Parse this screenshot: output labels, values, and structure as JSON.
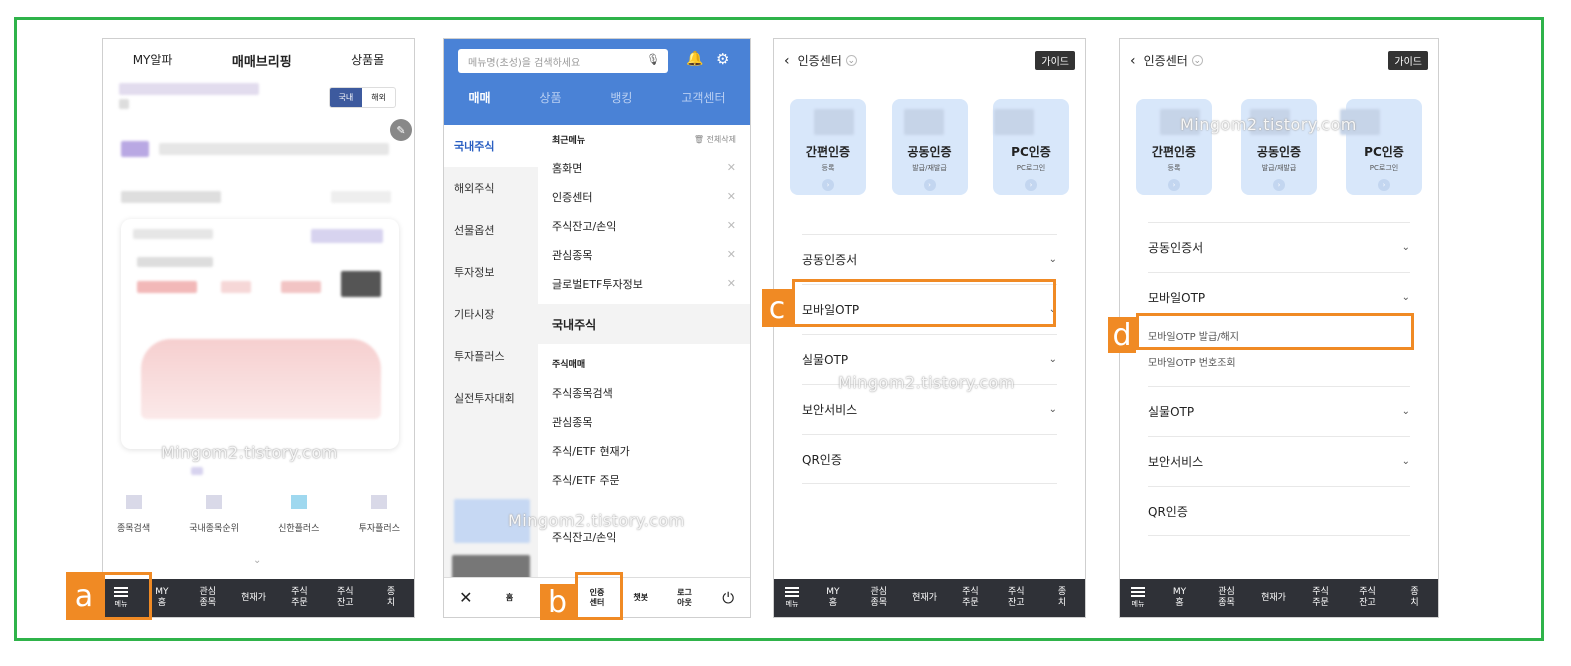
{
  "watermark": "Mingom2.tistory.com",
  "labels": {
    "a": "a",
    "b": "b",
    "c": "c",
    "d": "d"
  },
  "colors": {
    "frame": "#2fb34a",
    "highlight": "#f08a24",
    "header_blue": "#4a82d6"
  },
  "phone1": {
    "tabs": [
      "MY알파",
      "매매브리핑",
      "상품몰"
    ],
    "toggle": [
      "국내",
      "해외"
    ],
    "quick_menu": [
      "종목검색",
      "국내종목순위",
      "신한플러스",
      "투자플러스"
    ],
    "bottom_bar": {
      "menu": "메뉴",
      "items": [
        "MY\n홈",
        "관심\n종목",
        "현재가",
        "주식\n주문",
        "주식\n잔고",
        "종\n치"
      ]
    }
  },
  "phone2": {
    "search_placeholder": "메뉴명(초성)을 검색하세요",
    "tabs": [
      "매매",
      "상품",
      "뱅킹",
      "고객센터"
    ],
    "left_nav": [
      "국내주식",
      "해외주식",
      "선물옵션",
      "투자정보",
      "기타시장",
      "투자플러스",
      "실전투자대회"
    ],
    "recent_header": "최근메뉴",
    "delete_all": "전체삭제",
    "recent_items": [
      "홈화면",
      "인증센터",
      "주식잔고/손익",
      "관심종목",
      "글로벌ETF투자정보"
    ],
    "section_title": "국내주식",
    "sub_title": "주식매매",
    "items": [
      "주식종목검색",
      "관심종목",
      "주식/ETF 현재가",
      "주식/ETF 주문",
      "주식잔고/손익"
    ],
    "bottom": [
      "홈",
      "인증\n센터",
      "챗봇",
      "로그\n아웃"
    ]
  },
  "cert": {
    "title": "인증센터",
    "guide": "가이드",
    "tiles": [
      {
        "name": "간편인증",
        "sub": "등록"
      },
      {
        "name": "공동인증",
        "sub": "발급/재발급"
      },
      {
        "name": "PC인증",
        "sub": "PC로그인"
      }
    ],
    "rows": [
      "공동인증서",
      "모바일OTP",
      "실물OTP",
      "보안서비스",
      "QR인증"
    ],
    "otp_sub": [
      "모바일OTP 발급/해지",
      "모바일OTP 번호조회"
    ],
    "bottom_bar": {
      "menu": "메뉴",
      "items": [
        "MY\n홈",
        "관심\n종목",
        "현재가",
        "주식\n주문",
        "주식\n잔고",
        "종\n치"
      ]
    }
  }
}
